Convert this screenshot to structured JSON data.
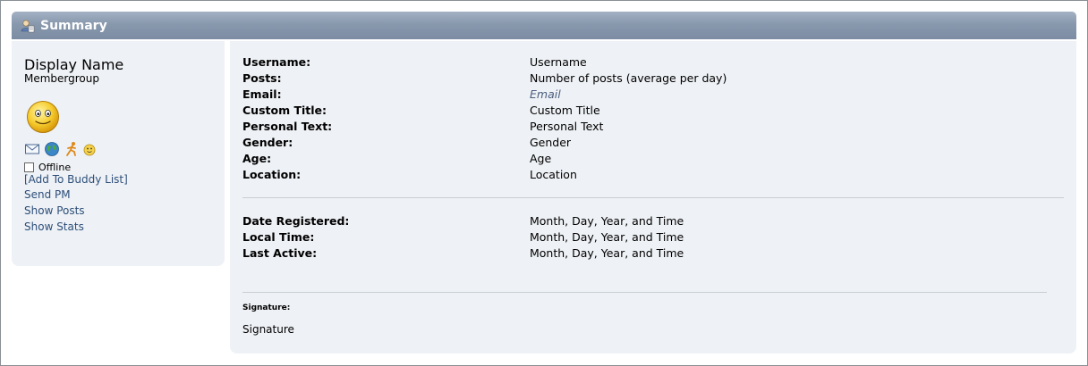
{
  "header": {
    "title": "Summary",
    "icon": "user-summary-icon"
  },
  "profile": {
    "display_name": "Display Name",
    "membergroup": "Membergroup",
    "avatar": "smiley-avatar",
    "icons": [
      "email-icon",
      "website-globe-icon",
      "msn-runner-icon",
      "smiley-icon"
    ],
    "status": "Offline",
    "links": {
      "add_buddy": "[Add To Buddy List]",
      "send_pm": "Send PM",
      "show_posts": "Show Posts",
      "show_stats": "Show Stats"
    }
  },
  "details": [
    {
      "label": "Username:",
      "value": "Username"
    },
    {
      "label": "Posts:",
      "value": "Number of posts (average per day)"
    },
    {
      "label": "Email:",
      "value": "Email"
    },
    {
      "label": "Custom Title:",
      "value": "Custom Title"
    },
    {
      "label": "Personal Text:",
      "value": "Personal Text"
    },
    {
      "label": "Gender:",
      "value": "Gender"
    },
    {
      "label": "Age:",
      "value": "Age"
    },
    {
      "label": "Location:",
      "value": "Location"
    }
  ],
  "dates": [
    {
      "label": "Date Registered:",
      "value": "Month, Day, Year, and Time"
    },
    {
      "label": "Local Time:",
      "value": "Month, Day, Year, and Time"
    },
    {
      "label": "Last Active:",
      "value": "Month, Day, Year, and Time"
    }
  ],
  "signature": {
    "label": "Signature:",
    "text": "Signature"
  },
  "colors": {
    "header_bar": "#8898ad",
    "panel_bg": "#eef1f5",
    "link": "#2d4f7a"
  }
}
